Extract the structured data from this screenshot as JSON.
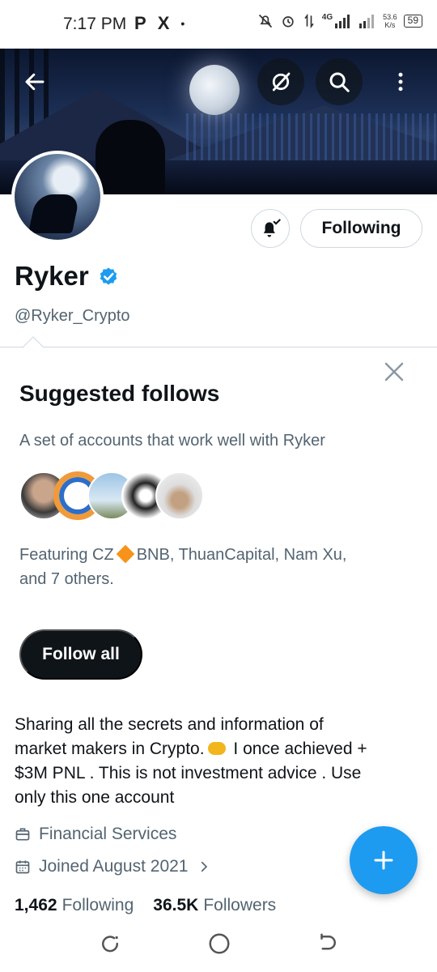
{
  "status_bar": {
    "time": "7:17 PM",
    "left_icons": [
      "P",
      "X",
      "•"
    ],
    "network_label": "4G",
    "speed_value": "53.6",
    "speed_unit": "K/s",
    "battery": "59"
  },
  "header": {
    "back_icon": "arrow-left-icon",
    "grok_icon": "grok-icon",
    "search_icon": "search-icon",
    "more_icon": "more-vertical-icon"
  },
  "profile": {
    "display_name": "Ryker",
    "handle": "@Ryker_Crypto",
    "verified": true,
    "notification_icon": "bell-check-icon",
    "follow_state_label": "Following",
    "bio": "Sharing all the secrets and information of market makers in Crypto. 🤝 I once achieved +$3M PNL . This is not investment advice . Use only this one account",
    "bio_line1": "Sharing all the secrets and information of",
    "bio_line2_a": "market makers in Crypto.",
    "bio_line2_b": " I once achieved +",
    "bio_line3": "$3M PNL . This is not investment advice . Use",
    "bio_line4": "only this one account",
    "category": "Financial Services",
    "joined": "Joined August 2021",
    "following_count": "1,462",
    "following_label": "Following",
    "followers_count": "36.5K",
    "followers_label": "Followers"
  },
  "suggested": {
    "title": "Suggested follows",
    "subtitle": "A set of accounts that work well with Ryker",
    "featuring_a": "Featuring CZ",
    "featuring_b": "BNB, ThuanCapital, Nam Xu,",
    "featuring_c": "and 7 others.",
    "follow_all_label": "Follow all"
  },
  "colors": {
    "accent": "#1d9bf0",
    "text_primary": "#0f1419",
    "text_secondary": "#536471",
    "border": "#cfd9de"
  }
}
